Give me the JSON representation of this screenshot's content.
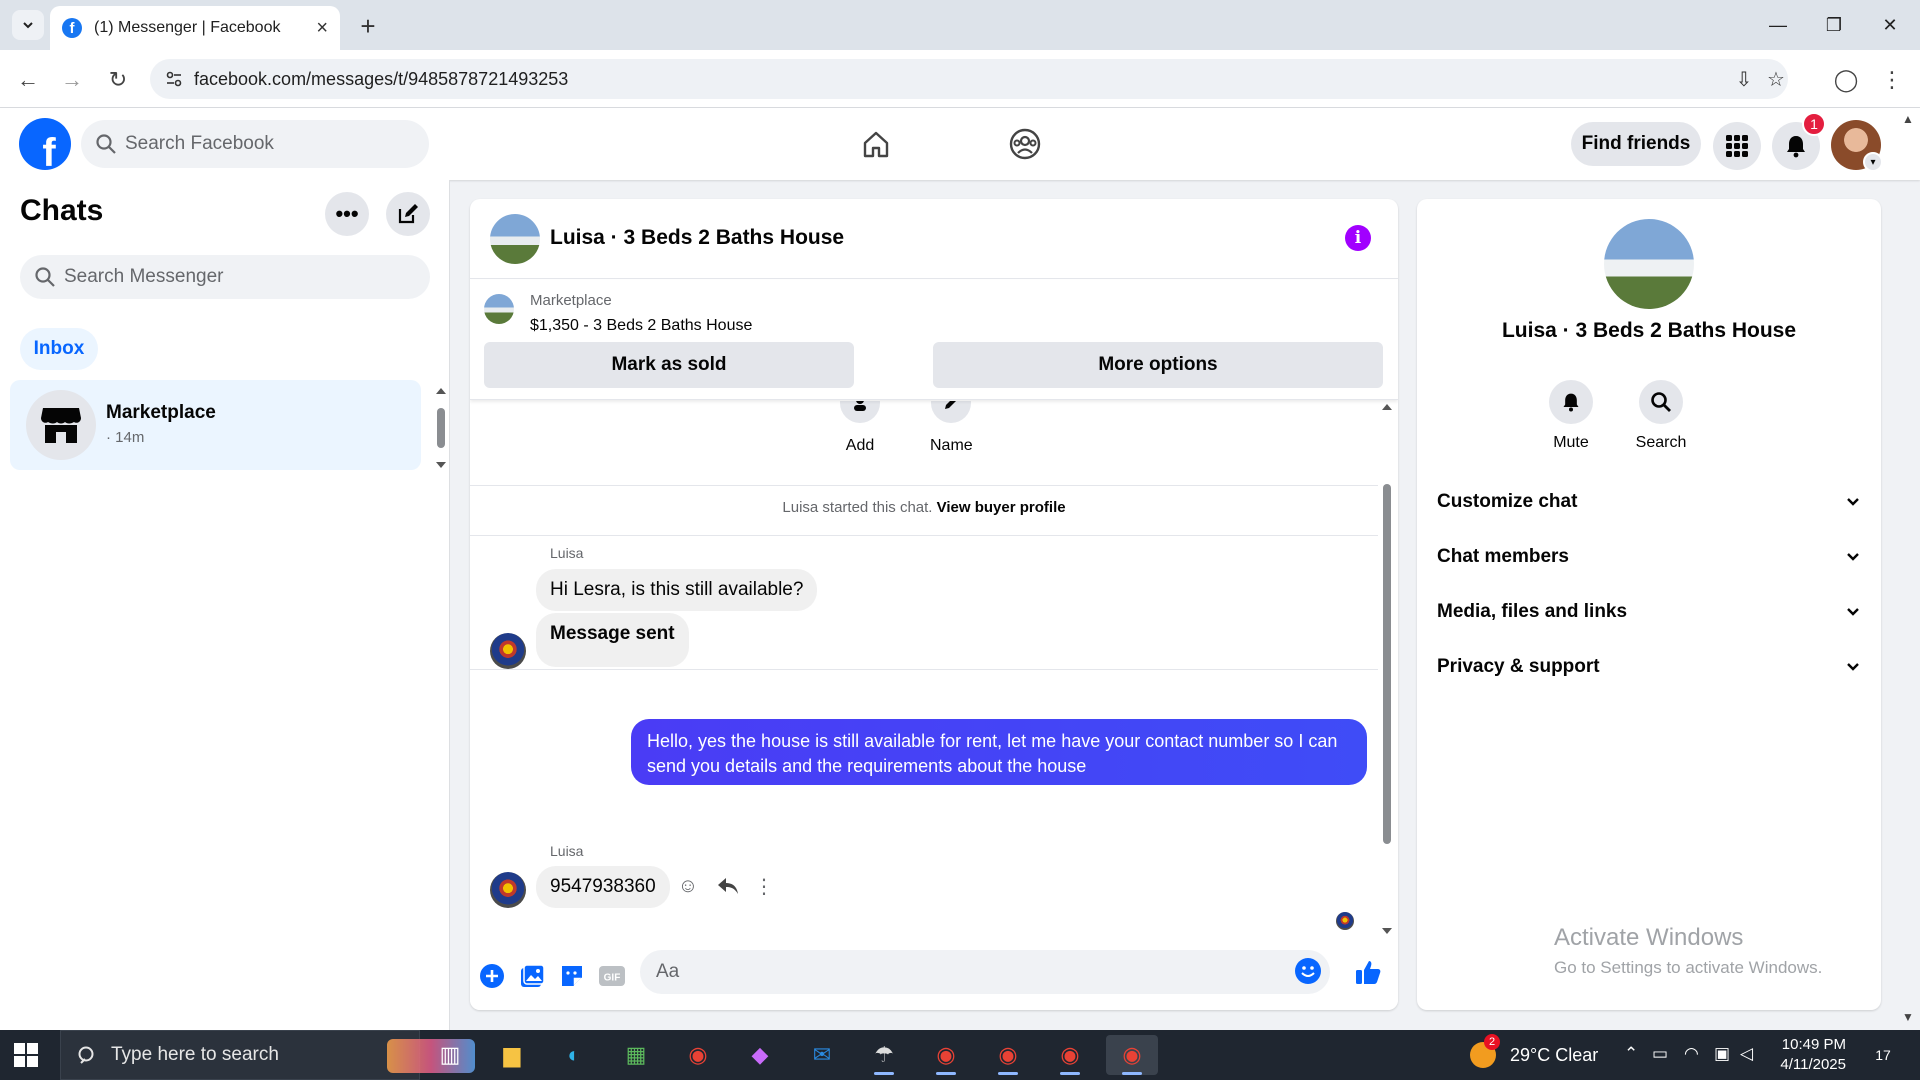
{
  "browser": {
    "tab_title": "(1) Messenger | Facebook",
    "favicon_letter": "f",
    "url": "facebook.com/messages/t/9485878721493253"
  },
  "fb_header": {
    "logo_letter": "f",
    "search_placeholder": "Search Facebook",
    "find_friends_label": "Find friends",
    "notification_count": "1"
  },
  "chats_panel": {
    "title": "Chats",
    "search_placeholder": "Search Messenger",
    "inbox_label": "Inbox",
    "items": [
      {
        "name": "Marketplace",
        "time": "· 14m"
      }
    ]
  },
  "conversation": {
    "title": "Luisa · 3 Beds 2 Baths House",
    "marketplace_label": "Marketplace",
    "listing": "$1,350 - 3 Beds 2 Baths House",
    "mark_sold_label": "Mark as sold",
    "more_options_label": "More options",
    "actions": [
      {
        "label": "Add",
        "icon": "add-person-icon"
      },
      {
        "label": "Name",
        "icon": "pencil-icon"
      }
    ],
    "started_text": "Luisa started this chat.",
    "buyer_profile_link": "View buyer profile",
    "messages": [
      {
        "sender": "Luisa",
        "text": "Hi Lesra, is this still available?",
        "direction": "incoming"
      },
      {
        "text": "Message sent",
        "direction": "incoming"
      },
      {
        "text": "Hello, yes the house is still available for rent, let me have your contact number so I can send you details and the requirements about the house",
        "direction": "outgoing"
      },
      {
        "sender": "Luisa",
        "text": "9547938360",
        "direction": "incoming"
      }
    ],
    "composer_placeholder": "Aa",
    "gif_label": "GIF"
  },
  "details_panel": {
    "title": "Luisa · 3 Beds 2 Baths House",
    "mute_label": "Mute",
    "search_label": "Search",
    "sections": [
      "Customize chat",
      "Chat members",
      "Media, files and links",
      "Privacy & support"
    ],
    "watermark_title": "Activate Windows",
    "watermark_sub": "Go to Settings to activate Windows."
  },
  "taskbar": {
    "search_placeholder": "Type here to search",
    "weather_badge": "2",
    "weather": "29°C  Clear",
    "time": "10:49 PM",
    "date": "4/11/2025",
    "notification_count": "17"
  },
  "colors": {
    "fb_blue": "#0866ff",
    "outgoing_bubble": "#4a3cf5",
    "info_purple": "#a100ff",
    "badge_red": "#e41e3f"
  }
}
